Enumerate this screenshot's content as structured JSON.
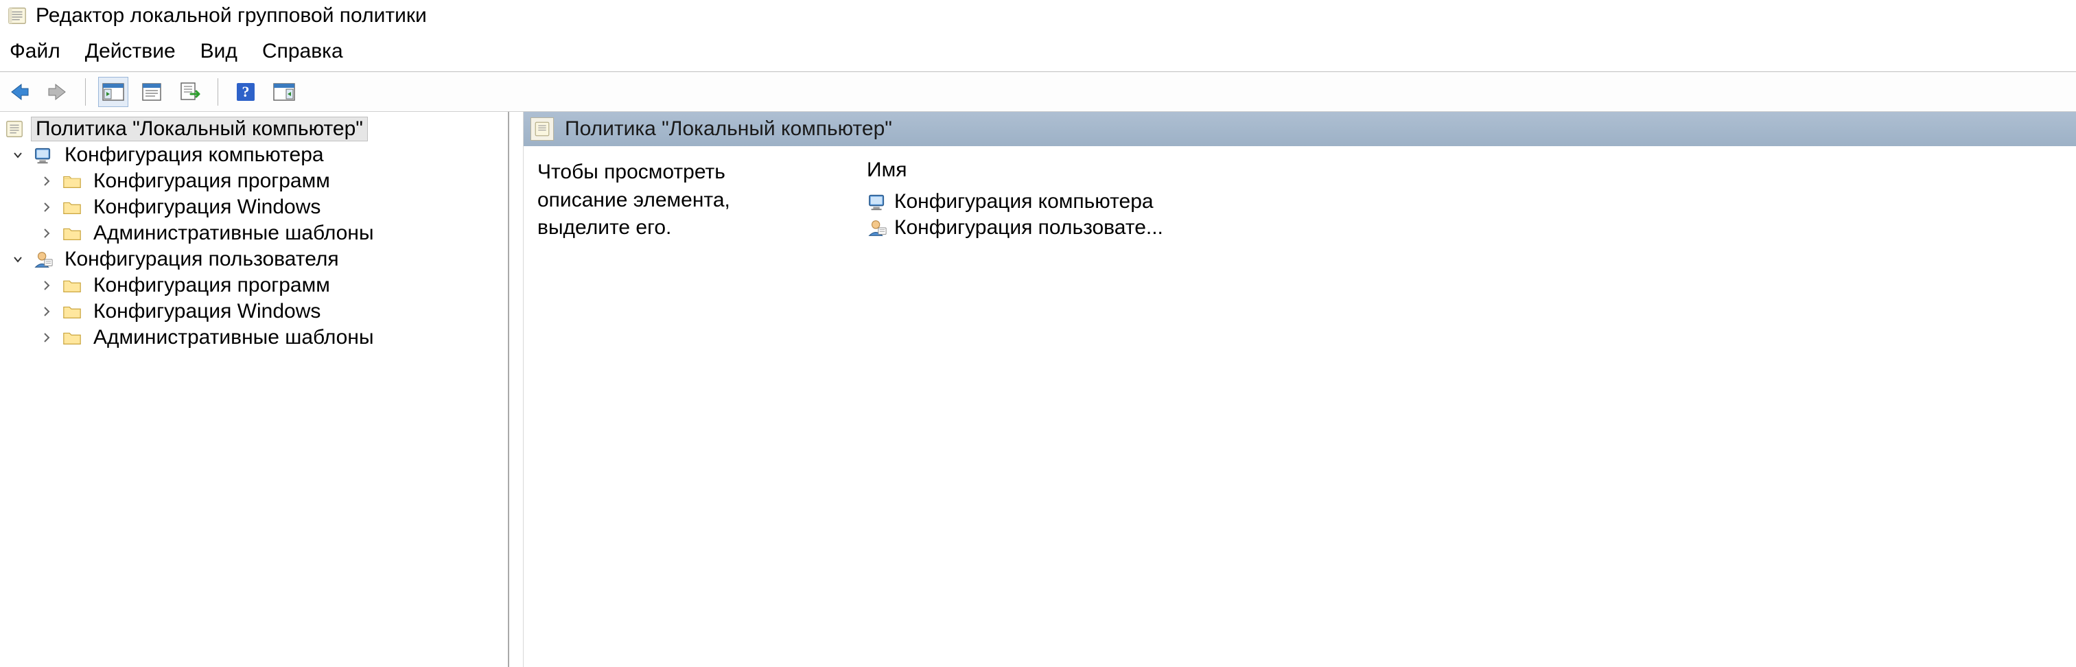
{
  "app_title": "Редактор локальной групповой политики",
  "menu": {
    "file": "Файл",
    "action": "Действие",
    "view": "Вид",
    "help": "Справка"
  },
  "tree": {
    "root": "Политика \"Локальный компьютер\"",
    "computer_config": "Конфигурация компьютера",
    "user_config": "Конфигурация пользователя",
    "software_settings": "Конфигурация программ",
    "windows_settings": "Конфигурация Windows",
    "admin_templates": "Административные шаблоны"
  },
  "right_panel": {
    "header": "Политика \"Локальный компьютер\"",
    "description": "Чтобы просмотреть описание элемента, выделите его.",
    "column_name": "Имя",
    "items": [
      "Конфигурация компьютера",
      "Конфигурация пользовате..."
    ]
  }
}
